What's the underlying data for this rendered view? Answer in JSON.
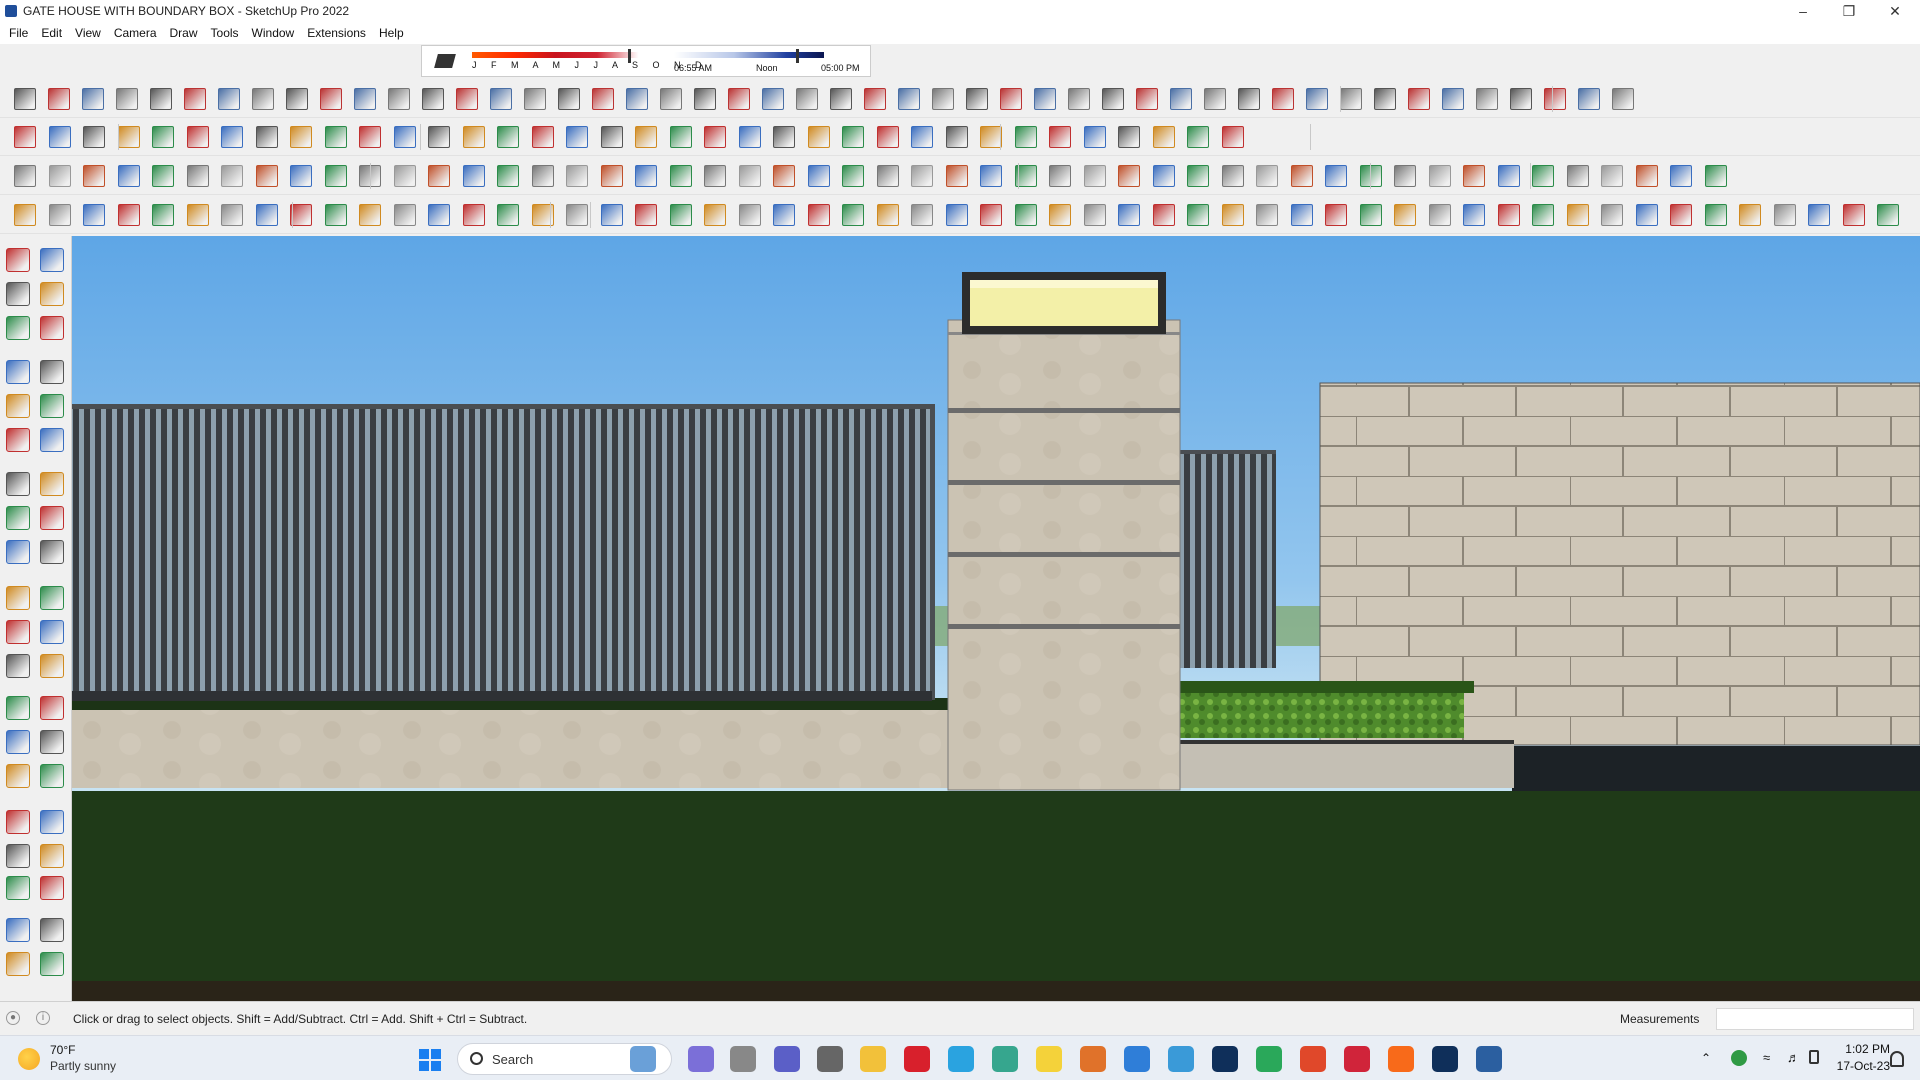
{
  "window": {
    "title": "GATE HOUSE WITH BOUNDARY BOX - SketchUp Pro 2022",
    "controls": [
      "minimize",
      "restore",
      "close"
    ]
  },
  "menu": [
    "File",
    "Edit",
    "View",
    "Camera",
    "Draw",
    "Tools",
    "Window",
    "Extensions",
    "Help"
  ],
  "shadows": {
    "months": "J F M A M J J A S O N D",
    "time_start": "06:55 AM",
    "time_mid": "Noon",
    "time_end": "05:00 PM"
  },
  "status": {
    "hint": "Click or drag to select objects. Shift = Add/Subtract. Ctrl = Add. Shift + Ctrl = Subtract.",
    "measurements_label": "Measurements",
    "measurements_value": ""
  },
  "taskbar": {
    "weather_temp": "70°F",
    "weather_cond": "Partly sunny",
    "search_placeholder": "Search",
    "time": "1:02 PM",
    "date": "17-Oct-23"
  },
  "colors": {
    "sky_top": "#5ea6e6",
    "grass": "#1f3a18",
    "fence": "#3e4246",
    "stone": "#cbc2b1",
    "light_box": "#f3f0a8"
  }
}
